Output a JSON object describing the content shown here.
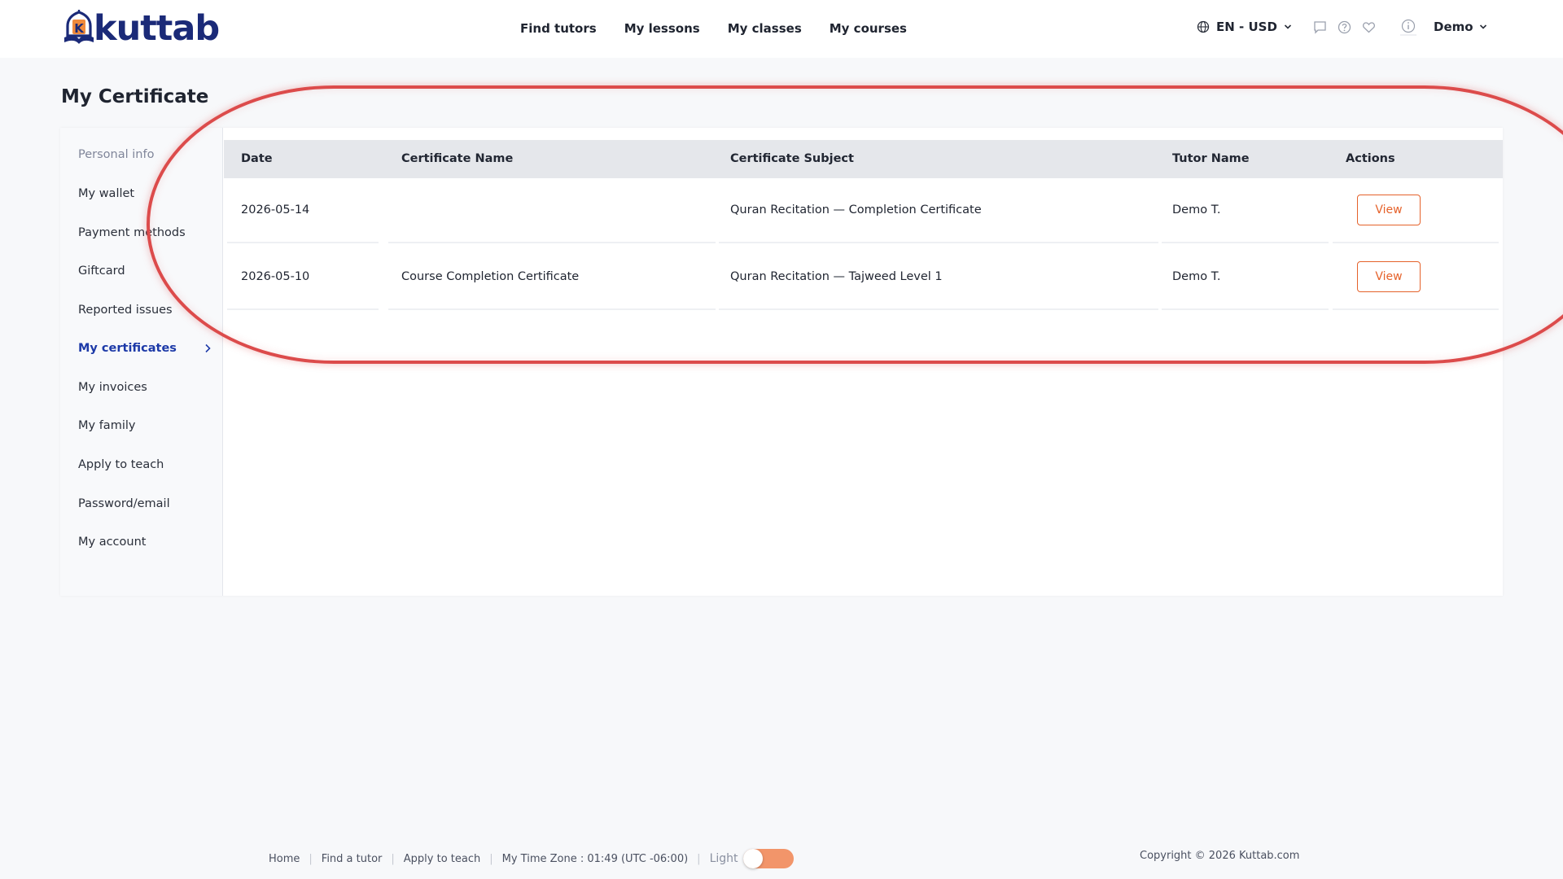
{
  "brand": {
    "name": "kuttab",
    "mark_letter": "K"
  },
  "nav": [
    {
      "label": "Find tutors"
    },
    {
      "label": "My lessons"
    },
    {
      "label": "My classes"
    },
    {
      "label": "My courses"
    }
  ],
  "header": {
    "lang_currency": "EN - USD",
    "user_name": "Demo",
    "icons": [
      "globe-icon",
      "chat-icon",
      "help-icon",
      "heart-icon",
      "info-icon"
    ]
  },
  "page": {
    "title": "My Certificate"
  },
  "sidebar": {
    "items": [
      {
        "label": "Personal info"
      },
      {
        "label": "My wallet"
      },
      {
        "label": "Payment methods"
      },
      {
        "label": "Giftcard"
      },
      {
        "label": "Reported issues"
      },
      {
        "label": "My certificates"
      },
      {
        "label": "My invoices"
      },
      {
        "label": "My family"
      },
      {
        "label": "Apply to teach"
      },
      {
        "label": "Password/email"
      },
      {
        "label": "My account"
      }
    ],
    "active_index": 5
  },
  "table": {
    "headers": [
      "Date",
      "Certificate Name",
      "Certificate Subject",
      "Tutor Name",
      "Actions"
    ],
    "rows": [
      {
        "date": "2026-05-14",
        "name": "",
        "subject": "Quran Recitation — Completion Certificate",
        "tutor": "Demo T.",
        "action": "View"
      },
      {
        "date": "2026-05-10",
        "name": "Course Completion Certificate",
        "subject": "Quran Recitation — Tajweed Level 1",
        "tutor": "Demo T.",
        "action": "View"
      }
    ]
  },
  "footer": {
    "links": [
      "Home",
      "Find a tutor",
      "Apply to teach"
    ],
    "timezone": "My Time Zone : 01:49 (UTC -06:00)",
    "theme_label": "Light",
    "copyright": "Copyright © 2026 Kuttab.com"
  },
  "colors": {
    "brand_navy": "#1b2a78",
    "accent_orange": "#e5622b",
    "active_blue": "#1d3aa8",
    "highlight_red": "#dc4b4b"
  }
}
